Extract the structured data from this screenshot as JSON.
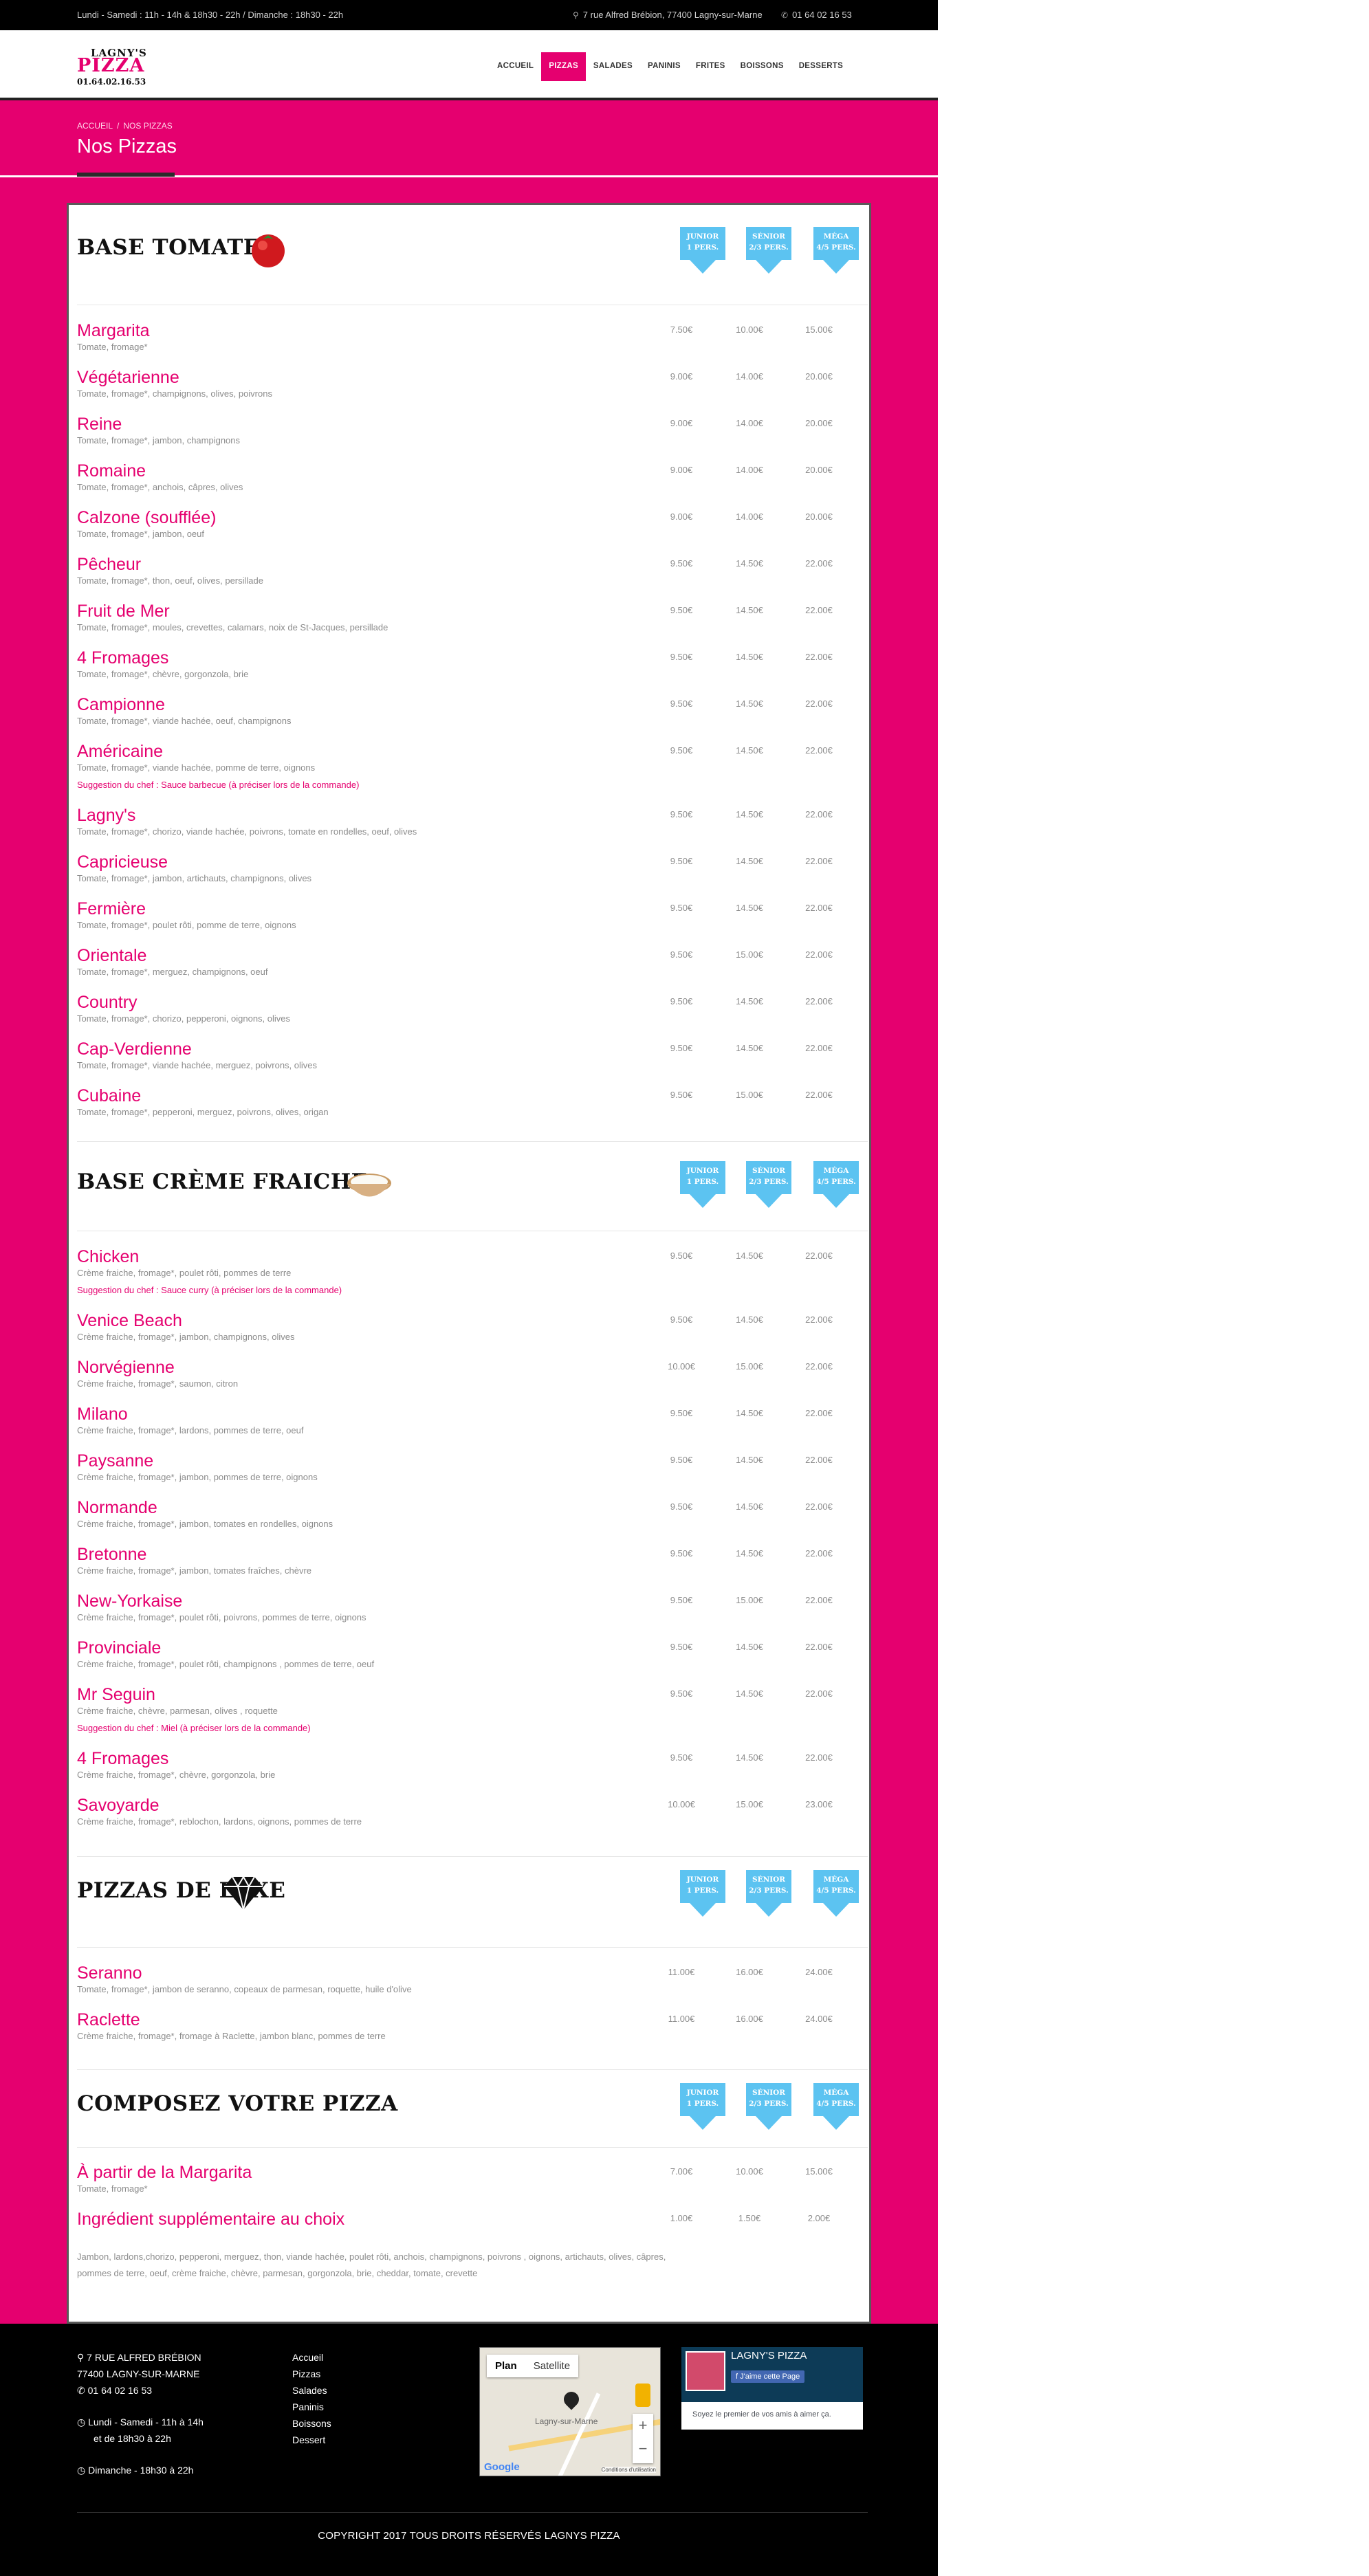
{
  "topbar": {
    "hours": "Lundi - Samedi : 11h - 14h & 18h30 - 22h / Dimanche : 18h30 - 22h",
    "address": "7 rue Alfred Brébion, 77400 Lagny-sur-Marne",
    "phone": "01 64 02 16 53"
  },
  "logo": {
    "line1": "LAGNY'S",
    "line2": "PIZZA",
    "line3": "01.64.02.16.53"
  },
  "nav": [
    {
      "label": "ACCUEIL",
      "active": false
    },
    {
      "label": "PIZZAS",
      "active": true
    },
    {
      "label": "SALADES",
      "active": false
    },
    {
      "label": "PANINIS",
      "active": false
    },
    {
      "label": "FRITES",
      "active": false
    },
    {
      "label": "BOISSONS",
      "active": false
    },
    {
      "label": "DESSERTS",
      "active": false
    }
  ],
  "breadcrumb": {
    "home": "ACCUEIL",
    "sep": "/",
    "current": "NOS PIZZAS"
  },
  "page_title": "Nos Pizzas",
  "size_tags": [
    {
      "name": "JUNIOR",
      "pers": "1 PERS."
    },
    {
      "name": "SÉNIOR",
      "pers": "2/3 PERS."
    },
    {
      "name": "MÉGA",
      "pers": "4/5 PERS."
    }
  ],
  "sections": [
    {
      "title": "BASE TOMATE",
      "icon": "tomato-icon",
      "items": [
        {
          "name": "Margarita",
          "desc": "Tomate, fromage*",
          "prices": [
            "7.50€",
            "10.00€",
            "15.00€"
          ]
        },
        {
          "name": "Végétarienne",
          "desc": "Tomate, fromage*, champignons, olives, poivrons",
          "prices": [
            "9.00€",
            "14.00€",
            "20.00€"
          ]
        },
        {
          "name": "Reine",
          "desc": "Tomate, fromage*, jambon, champignons",
          "prices": [
            "9.00€",
            "14.00€",
            "20.00€"
          ]
        },
        {
          "name": "Romaine",
          "desc": "Tomate, fromage*, anchois, câpres, olives",
          "prices": [
            "9.00€",
            "14.00€",
            "20.00€"
          ]
        },
        {
          "name": "Calzone (soufflée)",
          "desc": "Tomate, fromage*, jambon, oeuf",
          "prices": [
            "9.00€",
            "14.00€",
            "20.00€"
          ]
        },
        {
          "name": "Pêcheur",
          "desc": "Tomate, fromage*, thon, oeuf, olives, persillade",
          "prices": [
            "9.50€",
            "14.50€",
            "22.00€"
          ]
        },
        {
          "name": "Fruit de Mer",
          "desc": "Tomate, fromage*, moules, crevettes, calamars, noix de St-Jacques, persillade",
          "prices": [
            "9.50€",
            "14.50€",
            "22.00€"
          ]
        },
        {
          "name": "4 Fromages",
          "desc": "Tomate, fromage*, chèvre, gorgonzola, brie",
          "prices": [
            "9.50€",
            "14.50€",
            "22.00€"
          ]
        },
        {
          "name": "Campionne",
          "desc": "Tomate, fromage*, viande hachée, oeuf, champignons",
          "prices": [
            "9.50€",
            "14.50€",
            "22.00€"
          ]
        },
        {
          "name": "Américaine",
          "desc": "Tomate, fromage*, viande hachée, pomme de terre, oignons",
          "suggestion": "Suggestion du chef : Sauce barbecue (à préciser lors de la commande)",
          "prices": [
            "9.50€",
            "14.50€",
            "22.00€"
          ]
        },
        {
          "name": "Lagny's",
          "desc": "Tomate, fromage*, chorizo, viande hachée, poivrons, tomate en rondelles, oeuf, olives",
          "prices": [
            "9.50€",
            "14.50€",
            "22.00€"
          ]
        },
        {
          "name": "Capricieuse",
          "desc": "Tomate, fromage*, jambon, artichauts, champignons, olives",
          "prices": [
            "9.50€",
            "14.50€",
            "22.00€"
          ]
        },
        {
          "name": "Fermière",
          "desc": "Tomate, fromage*, poulet rôti, pomme de terre, oignons",
          "prices": [
            "9.50€",
            "14.50€",
            "22.00€"
          ]
        },
        {
          "name": "Orientale",
          "desc": "Tomate, fromage*, merguez, champignons, oeuf",
          "prices": [
            "9.50€",
            "15.00€",
            "22.00€"
          ]
        },
        {
          "name": "Country",
          "desc": "Tomate, fromage*, chorizo, pepperoni, oignons, olives",
          "prices": [
            "9.50€",
            "14.50€",
            "22.00€"
          ]
        },
        {
          "name": "Cap-Verdienne",
          "desc": "Tomate, fromage*, viande hachée, merguez, poivrons, olives",
          "prices": [
            "9.50€",
            "14.50€",
            "22.00€"
          ]
        },
        {
          "name": "Cubaine",
          "desc": "Tomate, fromage*, pepperoni, merguez, poivrons, olives, origan",
          "prices": [
            "9.50€",
            "15.00€",
            "22.00€"
          ]
        }
      ]
    },
    {
      "title": "BASE CRÈME FRAICHE",
      "icon": "cream-bowl-icon",
      "items": [
        {
          "name": "Chicken",
          "desc": "Crème fraiche, fromage*, poulet rôti, pommes de terre",
          "suggestion": "Suggestion du chef : Sauce curry (à préciser lors de la commande)",
          "prices": [
            "9.50€",
            "14.50€",
            "22.00€"
          ]
        },
        {
          "name": "Venice Beach",
          "desc": "Crème fraiche, fromage*, jambon, champignons, olives",
          "prices": [
            "9.50€",
            "14.50€",
            "22.00€"
          ]
        },
        {
          "name": "Norvégienne",
          "desc": "Crème fraiche, fromage*, saumon, citron",
          "prices": [
            "10.00€",
            "15.00€",
            "22.00€"
          ]
        },
        {
          "name": "Milano",
          "desc": "Crème fraiche, fromage*, lardons, pommes de terre, oeuf",
          "prices": [
            "9.50€",
            "14.50€",
            "22.00€"
          ]
        },
        {
          "name": "Paysanne",
          "desc": "Crème fraiche, fromage*, jambon, pommes de terre, oignons",
          "prices": [
            "9.50€",
            "14.50€",
            "22.00€"
          ]
        },
        {
          "name": "Normande",
          "desc": "Crème fraiche, fromage*, jambon, tomates en rondelles, oignons",
          "prices": [
            "9.50€",
            "14.50€",
            "22.00€"
          ]
        },
        {
          "name": "Bretonne",
          "desc": "Crème fraiche, fromage*, jambon, tomates fraîches, chèvre",
          "prices": [
            "9.50€",
            "14.50€",
            "22.00€"
          ]
        },
        {
          "name": "New-Yorkaise",
          "desc": "Crème fraiche, fromage*, poulet rôti, poivrons, pommes de terre, oignons",
          "prices": [
            "9.50€",
            "15.00€",
            "22.00€"
          ]
        },
        {
          "name": "Provinciale",
          "desc": "Crème fraiche, fromage*, poulet rôti, champignons , pommes de terre, oeuf",
          "prices": [
            "9.50€",
            "14.50€",
            "22.00€"
          ]
        },
        {
          "name": "Mr Seguin",
          "desc": "Crème fraiche, chèvre, parmesan, olives , roquette",
          "suggestion": "Suggestion du chef : Miel (à préciser lors de la commande)",
          "prices": [
            "9.50€",
            "14.50€",
            "22.00€"
          ]
        },
        {
          "name": "4 Fromages",
          "desc": "Crème fraiche, fromage*, chèvre, gorgonzola, brie",
          "prices": [
            "9.50€",
            "14.50€",
            "22.00€"
          ]
        },
        {
          "name": "Savoyarde",
          "desc": "Crème fraiche, fromage*, reblochon, lardons, oignons, pommes de terre",
          "prices": [
            "10.00€",
            "15.00€",
            "23.00€"
          ]
        }
      ]
    },
    {
      "title": "PIZZAS DE LUXE",
      "icon": "diamond-icon",
      "items": [
        {
          "name": "Seranno",
          "desc": "Tomate, fromage*, jambon de seranno, copeaux de parmesan, roquette, huile d'olive",
          "prices": [
            "11.00€",
            "16.00€",
            "24.00€"
          ]
        },
        {
          "name": "Raclette",
          "desc": "Crème fraiche, fromage*, fromage à Raclette, jambon blanc, pommes de terre",
          "prices": [
            "11.00€",
            "16.00€",
            "24.00€"
          ]
        }
      ]
    },
    {
      "title": "COMPOSEZ VOTRE PIZZA",
      "icon": "",
      "items": [
        {
          "name": "À partir de la Margarita",
          "desc": "Tomate, fromage*",
          "prices": [
            "7.00€",
            "10.00€",
            "15.00€"
          ]
        },
        {
          "name": "Ingrédient supplémentaire au choix",
          "desc": "",
          "prices": [
            "1.00€",
            "1.50€",
            "2.00€"
          ]
        }
      ]
    }
  ],
  "extras_text": "Jambon, lardons,chorizo, pepperoni, merguez, thon, viande hachée, poulet rôti, anchois, champignons, poivrons , oignons, artichauts, olives, câpres, pommes de terre, oeuf, crème fraiche, chèvre, parmesan, gorgonzola, brie, cheddar, tomate, crevette",
  "footer": {
    "address1": "7 RUE ALFRED BRÉBION",
    "address2": "77400 LAGNY-SUR-MARNE",
    "phone": "01 64 02 16 53",
    "hours1a": "Lundi - Samedi - 11h à 14h",
    "hours1b": "et de 18h30 à 22h",
    "hours2": "Dimanche - 18h30 à 22h",
    "links": [
      "Accueil",
      "Pizzas",
      "Salades",
      "Paninis",
      "Boissons",
      "Dessert"
    ],
    "map": {
      "tab_plan": "Plan",
      "tab_satellite": "Satellite",
      "place": "Lagny-sur-Marne",
      "google": "Google",
      "terms": "Conditions d'utilisation"
    },
    "facebook": {
      "page_name": "LAGNY'S PIZZA",
      "like": "J'aime cette Page",
      "text": "Soyez le premier de vos amis à aimer ça."
    },
    "copyright": "COPYRIGHT 2017 TOUS DROITS RÉSERVÉS LAGNYS PIZZA"
  }
}
